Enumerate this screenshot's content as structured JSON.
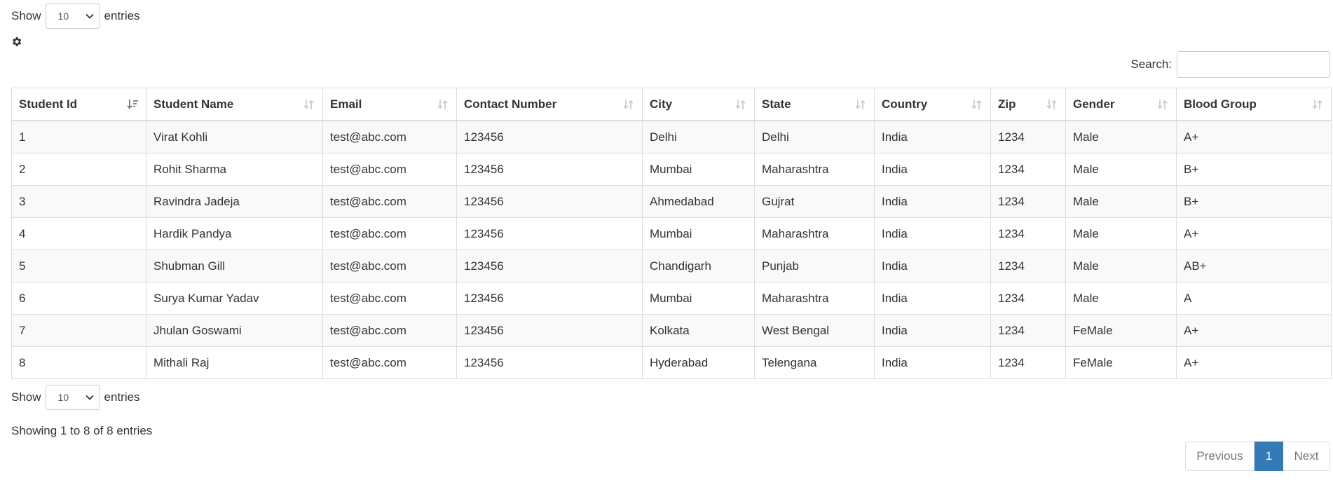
{
  "length_top": {
    "prefix": "Show",
    "value": "10",
    "suffix": "entries"
  },
  "length_bottom": {
    "prefix": "Show",
    "value": "10",
    "suffix": "entries"
  },
  "icons": {
    "settings": "gear-icon",
    "sort": "sort-icon",
    "sorted_asc": "sort-asc-icon",
    "dropdown": "chevron-down-icon"
  },
  "search": {
    "label": "Search:",
    "value": ""
  },
  "table": {
    "columns": [
      "Student Id",
      "Student Name",
      "Email",
      "Contact Number",
      "City",
      "State",
      "Country",
      "Zip",
      "Gender",
      "Blood Group"
    ],
    "rows": [
      [
        "1",
        "Virat Kohli",
        "test@abc.com",
        "123456",
        "Delhi",
        "Delhi",
        "India",
        "1234",
        "Male",
        "A+"
      ],
      [
        "2",
        "Rohit Sharma",
        "test@abc.com",
        "123456",
        "Mumbai",
        "Maharashtra",
        "India",
        "1234",
        "Male",
        "B+"
      ],
      [
        "3",
        "Ravindra Jadeja",
        "test@abc.com",
        "123456",
        "Ahmedabad",
        "Gujrat",
        "India",
        "1234",
        "Male",
        "B+"
      ],
      [
        "4",
        "Hardik Pandya",
        "test@abc.com",
        "123456",
        "Mumbai",
        "Maharashtra",
        "India",
        "1234",
        "Male",
        "A+"
      ],
      [
        "5",
        "Shubman Gill",
        "test@abc.com",
        "123456",
        "Chandigarh",
        "Punjab",
        "India",
        "1234",
        "Male",
        "AB+"
      ],
      [
        "6",
        "Surya Kumar Yadav",
        "test@abc.com",
        "123456",
        "Mumbai",
        "Maharashtra",
        "India",
        "1234",
        "Male",
        "A"
      ],
      [
        "7",
        "Jhulan Goswami",
        "test@abc.com",
        "123456",
        "Kolkata",
        "West Bengal",
        "India",
        "1234",
        "FeMale",
        "A+"
      ],
      [
        "8",
        "Mithali Raj",
        "test@abc.com",
        "123456",
        "Hyderabad",
        "Telengana",
        "India",
        "1234",
        "FeMale",
        "A+"
      ]
    ]
  },
  "info": "Showing 1 to 8 of 8 entries",
  "pagination": {
    "previous": "Previous",
    "current": "1",
    "next": "Next"
  },
  "colors": {
    "accent": "#337ab7",
    "border": "#dddddd",
    "stripe": "#f9f9f9",
    "text": "#333333"
  }
}
